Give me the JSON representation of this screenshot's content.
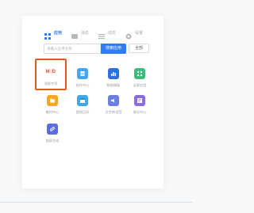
{
  "tabs": [
    {
      "label": "应用",
      "icon": "grid-icon",
      "active": true
    },
    {
      "label": "消息",
      "icon": "message-icon",
      "active": false
    },
    {
      "label": "动态",
      "icon": "list-icon",
      "active": false
    },
    {
      "label": "设置",
      "icon": "gear-icon",
      "active": false
    }
  ],
  "search": {
    "placeholder": "请输入应用名称",
    "submit_label": "搜索应用",
    "secondary_label": "全部"
  },
  "apps": [
    {
      "label": "消息专项",
      "icon": "message-text-icon",
      "color": "#e0523a"
    },
    {
      "label": "协作中心",
      "icon": "doc-icon",
      "color": "#4aa5f0"
    },
    {
      "label": "数据模板",
      "icon": "chart-bar-icon",
      "color": "#2f6fe0"
    },
    {
      "label": "全部应用",
      "icon": "apps-icon",
      "color": "#3dbb7a"
    },
    {
      "label": "素材中心",
      "icon": "folder-icon",
      "color": "#f5a623"
    },
    {
      "label": "营销日历",
      "icon": "calendar-icon",
      "color": "#42a7e8"
    },
    {
      "label": "文字转语音",
      "icon": "sound-icon",
      "color": "#6c7fe0"
    },
    {
      "label": "情况中心",
      "icon": "panel-icon",
      "color": "#8b6de0"
    },
    {
      "label": "链接生成",
      "icon": "link-icon",
      "color": "#5b6ee0"
    }
  ]
}
